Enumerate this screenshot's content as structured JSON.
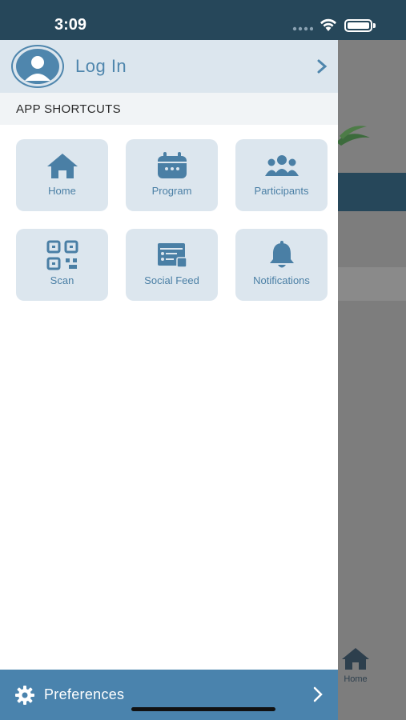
{
  "status_bar": {
    "time": "3:09"
  },
  "drawer": {
    "login": {
      "label": "Log In"
    },
    "shortcuts_title": "APP SHORTCUTS",
    "shortcuts": [
      {
        "label": "Home",
        "icon": "home-icon"
      },
      {
        "label": "Program",
        "icon": "calendar-icon"
      },
      {
        "label": "Participants",
        "icon": "people-icon"
      },
      {
        "label": "Scan",
        "icon": "qr-scan-icon"
      },
      {
        "label": "Social Feed",
        "icon": "social-feed-icon"
      },
      {
        "label": "Notifications",
        "icon": "bell-icon"
      }
    ],
    "preferences": {
      "label": "Preferences"
    }
  },
  "background_app": {
    "tab_home_label": "Home"
  },
  "colors": {
    "accent": "#4a83ad",
    "header": "#26475a",
    "tile_bg": "#dce6ee"
  }
}
